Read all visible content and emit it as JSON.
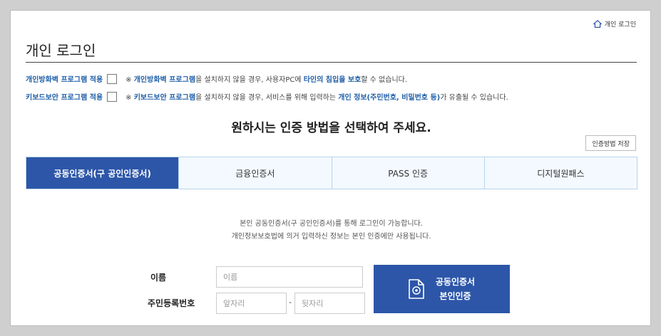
{
  "header": {
    "home_label": "개인 로그인",
    "title": "개인 로그인"
  },
  "options": [
    {
      "label": "개인방화벽 프로그램 적용",
      "note": {
        "prefix": "※ ",
        "hl1": "개인방화벽 프로그램",
        "mid1": "을 설치하지 않을 경우, 사용자PC에 ",
        "hl2": "타인의 침입을 보호",
        "suffix": "할 수 없습니다."
      }
    },
    {
      "label": "키보드보안 프로그램 적용",
      "note": {
        "prefix": "※ ",
        "hl1": "키보드보안 프로그램",
        "mid1": "을 설치하지 않을 경우, 서비스를 위해 입력하는 ",
        "hl2": "개인 정보(주민번호, 비밀번호 등)",
        "suffix": "가 유출될 수 있습니다."
      }
    }
  ],
  "headline": "원하시는 인증 방법을 선택하여 주세요.",
  "save_method_label": "인증방법 저장",
  "tabs": [
    {
      "label": "공동인증서(구 공인인증서)",
      "active": true
    },
    {
      "label": "금융인증서",
      "active": false
    },
    {
      "label": "PASS 인증",
      "active": false
    },
    {
      "label": "디지털원패스",
      "active": false
    }
  ],
  "description": [
    "본인 공동인증서(구 공인인증서)를 통해 로그인이 가능합니다.",
    "개인정보보호법에 의거 입력하신 정보는 본인 인증에만 사용됩니다."
  ],
  "form": {
    "name_label": "이름",
    "name_placeholder": "이름",
    "name_value": "",
    "rrn_label": "주민등록번호",
    "rrn_front_placeholder": "앞자리",
    "rrn_front_value": "",
    "rrn_separator": "-",
    "rrn_back_placeholder": "뒷자리",
    "rrn_back_value": ""
  },
  "cert_button": {
    "line1": "공동인증서",
    "line2": "본인인증",
    "icon": "certificate-icon"
  },
  "icons": {
    "home": "home-icon"
  },
  "colors": {
    "accent": "#2d56a8",
    "link_blue": "#1f5fa8",
    "tab_inactive_bg": "#f3f9ff",
    "tab_border": "#b9d3ea"
  }
}
